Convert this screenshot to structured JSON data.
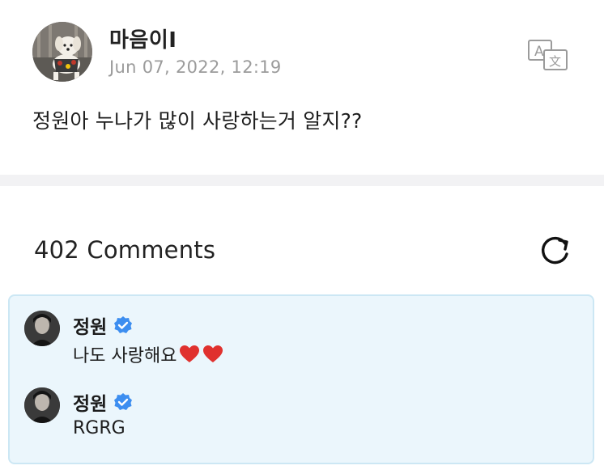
{
  "post": {
    "author_name": "마음이I",
    "date": "Jun 07, 2022, 12:19",
    "body_text": "정원아 누나가 많이 사랑하는거 알지??",
    "avatar_icon": "dog-avatar",
    "translate_icon": "translate-icon"
  },
  "comments_section": {
    "title": "402 Comments",
    "refresh_icon": "refresh-icon",
    "highlight_bg": "#ebf6fc",
    "highlight_border": "#cce7f4"
  },
  "replies": [
    {
      "author": "정원",
      "verified": true,
      "text": "나도 사랑해요",
      "emoji": [
        "heart-icon",
        "heart-icon"
      ]
    },
    {
      "author": "정원",
      "verified": true,
      "text": "RGRG",
      "emoji": []
    }
  ],
  "colors": {
    "verified_blue": "#3d8ef0",
    "heart_red": "#e0312e",
    "date_gray": "#9b9b9b"
  }
}
